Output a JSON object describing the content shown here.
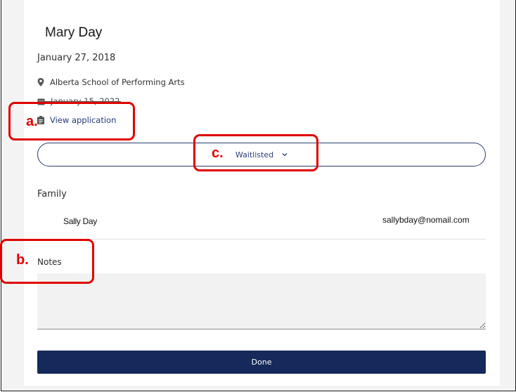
{
  "profile": {
    "first_name": "Mary",
    "last_name": "Day",
    "date": "January 27, 2018",
    "school": "Alberta School of Performing Arts",
    "secondary_date": "January 15, 2022",
    "view_application_label": "View application"
  },
  "status": {
    "selected": "Waitlisted"
  },
  "family": {
    "title": "Family",
    "members": [
      {
        "name": "Sally Day",
        "email": "sallybday@nomail.com"
      }
    ]
  },
  "notes": {
    "title": "Notes",
    "value": ""
  },
  "actions": {
    "done_label": "Done"
  },
  "annotations": {
    "a": "a.",
    "b": "b.",
    "c": "c."
  },
  "colors": {
    "primary": "#15295a",
    "link": "#24397a",
    "callout": "#e00000",
    "notes_bg": "#f2f2f2",
    "page_bg": "#f3f3f4"
  },
  "icons": {
    "location": "location-pin-icon",
    "calendar": "calendar-icon",
    "application": "clipboard-icon",
    "dropdown": "chevron-down-icon"
  }
}
